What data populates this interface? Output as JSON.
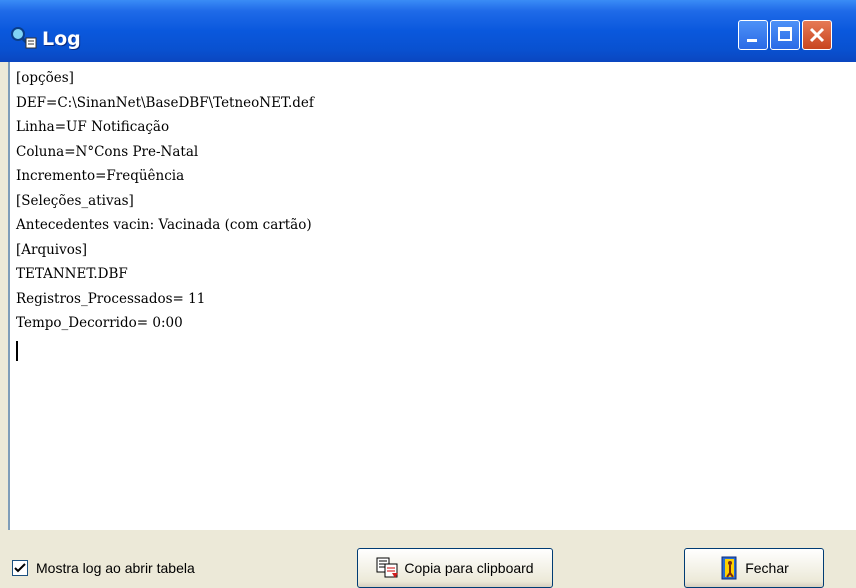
{
  "window": {
    "title": "Log"
  },
  "log": {
    "lines": [
      "[opções]",
      "DEF=C:\\SinanNet\\BaseDBF\\TetneoNET.def",
      "Linha=UF Notificação",
      "Coluna=N°Cons Pre-Natal",
      "Incremento=Freqüência",
      "[Seleções_ativas]",
      "Antecedentes vacin: Vacinada (com cartão)",
      "[Arquivos]",
      "TETANNET.DBF",
      "Registros_Processados= 11",
      "Tempo_Decorrido= 0:00"
    ]
  },
  "footer": {
    "checkbox_label": "Mostra log ao abrir tabela",
    "checkbox_checked": true,
    "copy_button": "Copia para clipboard",
    "close_button": "Fechar"
  },
  "icons": {
    "title": "log-search-icon",
    "copy": "clipboard-copy-icon",
    "close": "door-exit-icon"
  },
  "colors": {
    "titlebar": "#0a58dd",
    "close": "#c8451f",
    "face": "#ece9d8"
  }
}
